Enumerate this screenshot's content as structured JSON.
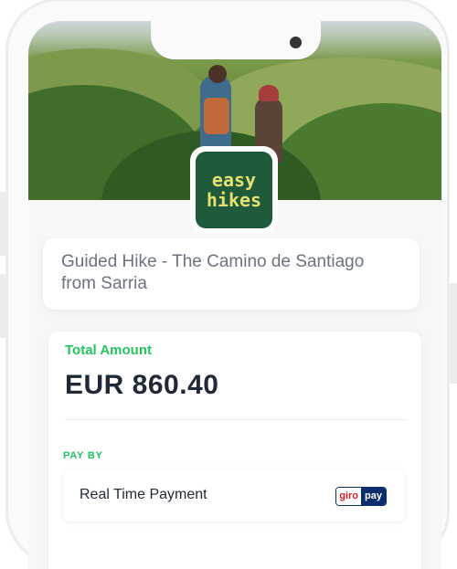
{
  "tour": {
    "title": "Guided Hike - The Camino de Santiago from Sarria"
  },
  "brand": {
    "logo_line1": "easy",
    "logo_line2": "hikes",
    "logo_bg": "#1f5a3b",
    "logo_text_color": "#e5e070"
  },
  "payment": {
    "total_label": "Total Amount",
    "total_value": "EUR 860.40",
    "pay_by_label": "PAY BY",
    "methods": [
      {
        "label": "Real Time Payment",
        "icon": "giropay-logo",
        "logo_part1": "giro",
        "logo_part2": "pay"
      }
    ]
  },
  "colors": {
    "accent": "#22c55e",
    "text_dark": "#1f2937",
    "text_muted": "#6b7280"
  }
}
